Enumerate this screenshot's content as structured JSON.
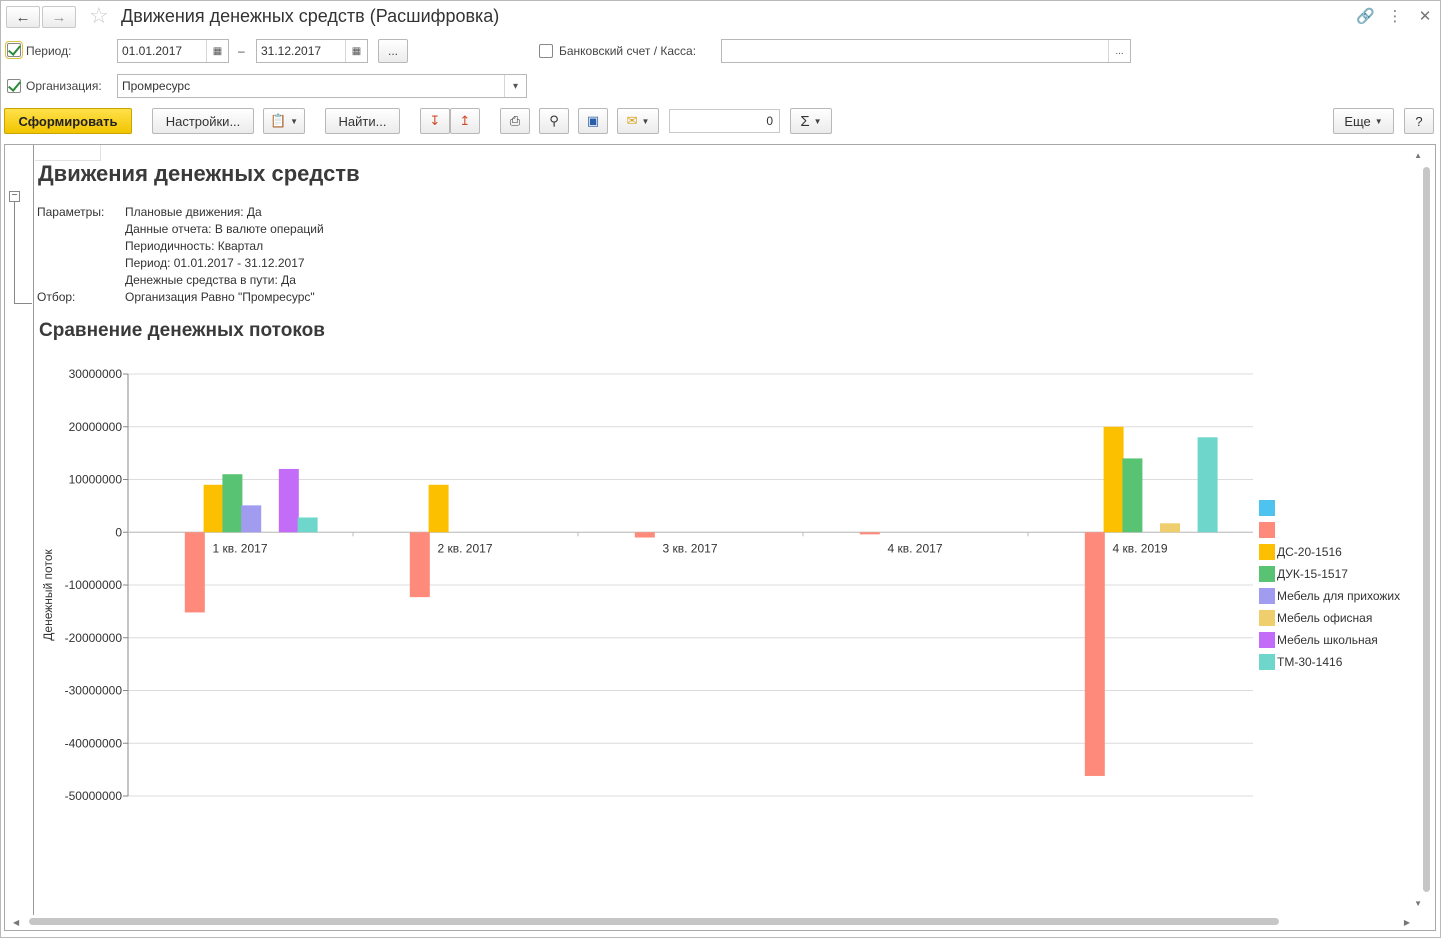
{
  "window": {
    "title": "Движения денежных средств (Расшифровка)"
  },
  "filters": {
    "period_label": "Период:",
    "date_from": "01.01.2017",
    "date_dash": "–",
    "date_to": "31.12.2017",
    "more_label": "...",
    "bank_label": "Банковский счет / Касса:",
    "bank_value": "",
    "org_label": "Организация:",
    "org_value": "Промресурс"
  },
  "toolbar": {
    "generate": "Сформировать",
    "settings": "Настройки...",
    "find": "Найти...",
    "amount": "0",
    "sum_symbol": "Σ",
    "more": "Еще",
    "help": "?"
  },
  "report": {
    "title": "Движения денежных средств",
    "params_label": "Параметры:",
    "params": [
      "Плановые движения: Да",
      "Данные отчета: В валюте операций",
      "Периодичность: Квартал",
      "Период: 01.01.2017 - 31.12.2017",
      "Денежные средства в пути: Да"
    ],
    "filter_label": "Отбор:",
    "filter_value": "Организация Равно \"Промресурс\"",
    "chart_title": "Сравнение денежных потоков"
  },
  "chart_data": {
    "type": "bar",
    "title": "Сравнение денежных потоков",
    "ylabel": "Денежный поток",
    "xlabel": "",
    "ylim": [
      -50000000,
      30000000
    ],
    "yticks": [
      30000000,
      20000000,
      10000000,
      0,
      -10000000,
      -20000000,
      -30000000,
      -40000000,
      -50000000
    ],
    "ytick_labels": [
      "30000000",
      "20000000",
      "10000000",
      "0",
      "-10000000",
      "-20000000",
      "-30000000",
      "-40000000",
      "-50000000"
    ],
    "categories": [
      "1 кв. 2017",
      "2 кв. 2017",
      "3 кв. 2017",
      "4 кв. 2017",
      "4 кв. 2019"
    ],
    "grid": true,
    "legend_position": "right",
    "series": [
      {
        "name": "",
        "color": "#4fc3f0",
        "values": [
          0,
          0,
          0,
          0,
          0
        ]
      },
      {
        "name": "",
        "color": "#fd8a7a",
        "values": [
          -15200000,
          -12300000,
          -1000000,
          -400000,
          -46200000
        ]
      },
      {
        "name": "ДС-20-1516",
        "color": "#fcc000",
        "values": [
          9000000,
          9000000,
          0,
          0,
          20000000
        ]
      },
      {
        "name": "ДУК-15-1517",
        "color": "#59c374",
        "values": [
          11000000,
          0,
          0,
          0,
          14000000
        ]
      },
      {
        "name": "Мебель для прихожих",
        "color": "#a19cf0",
        "values": [
          5100000,
          0,
          0,
          0,
          0
        ]
      },
      {
        "name": "Мебель офисная",
        "color": "#efce6e",
        "values": [
          0,
          0,
          0,
          0,
          1700000
        ]
      },
      {
        "name": "Мебель школьная",
        "color": "#c26cf7",
        "values": [
          12000000,
          0,
          0,
          0,
          0
        ]
      },
      {
        "name": "ТМ-30-1416",
        "color": "#6fd6cc",
        "values": [
          2800000,
          0,
          0,
          0,
          18000000
        ]
      }
    ]
  }
}
